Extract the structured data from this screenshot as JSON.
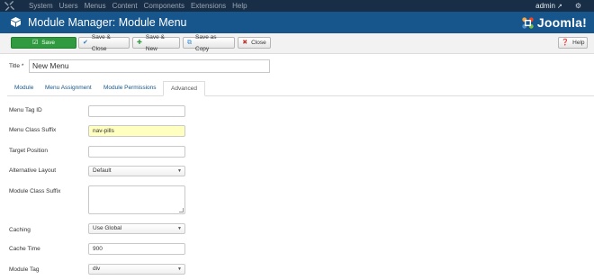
{
  "top_nav": {
    "items": [
      "System",
      "Users",
      "Menus",
      "Content",
      "Components",
      "Extensions",
      "Help"
    ],
    "user": "admin",
    "icons": [
      "joomla-icon",
      "external-link-icon",
      "gear-icon"
    ]
  },
  "header": {
    "title": "Module Manager: Module Menu",
    "brand": "Joomla!"
  },
  "toolbar": {
    "save_label": "Save",
    "save_close_label": "Save & Close",
    "save_new_label": "Save & New",
    "save_copy_label": "Save as Copy",
    "close_label": "Close",
    "help_label": "Help"
  },
  "form": {
    "title_label": "Title",
    "required_mark": "*",
    "title_value": "New Menu"
  },
  "tabs": [
    {
      "label": "Module",
      "active": false
    },
    {
      "label": "Menu Assignment",
      "active": false
    },
    {
      "label": "Module Permissions",
      "active": false
    },
    {
      "label": "Advanced",
      "active": true
    }
  ],
  "advanced": {
    "menu_tag_id": {
      "label": "Menu Tag ID",
      "value": ""
    },
    "menu_class_suffix": {
      "label": "Menu Class Suffix",
      "value": "nav-pills"
    },
    "target_position": {
      "label": "Target Position",
      "value": ""
    },
    "alternative_layout": {
      "label": "Alternative Layout",
      "value": "Default"
    },
    "module_class_suffix": {
      "label": "Module Class Suffix",
      "value": ""
    },
    "caching": {
      "label": "Caching",
      "value": "Use Global"
    },
    "cache_time": {
      "label": "Cache Time",
      "value": "900"
    },
    "module_tag": {
      "label": "Module Tag",
      "value": "div"
    }
  },
  "colors": {
    "top_nav": "#182e46",
    "header": "#17568c",
    "save_button": "#2f9a3f",
    "highlight_input": "#ffffc0"
  }
}
